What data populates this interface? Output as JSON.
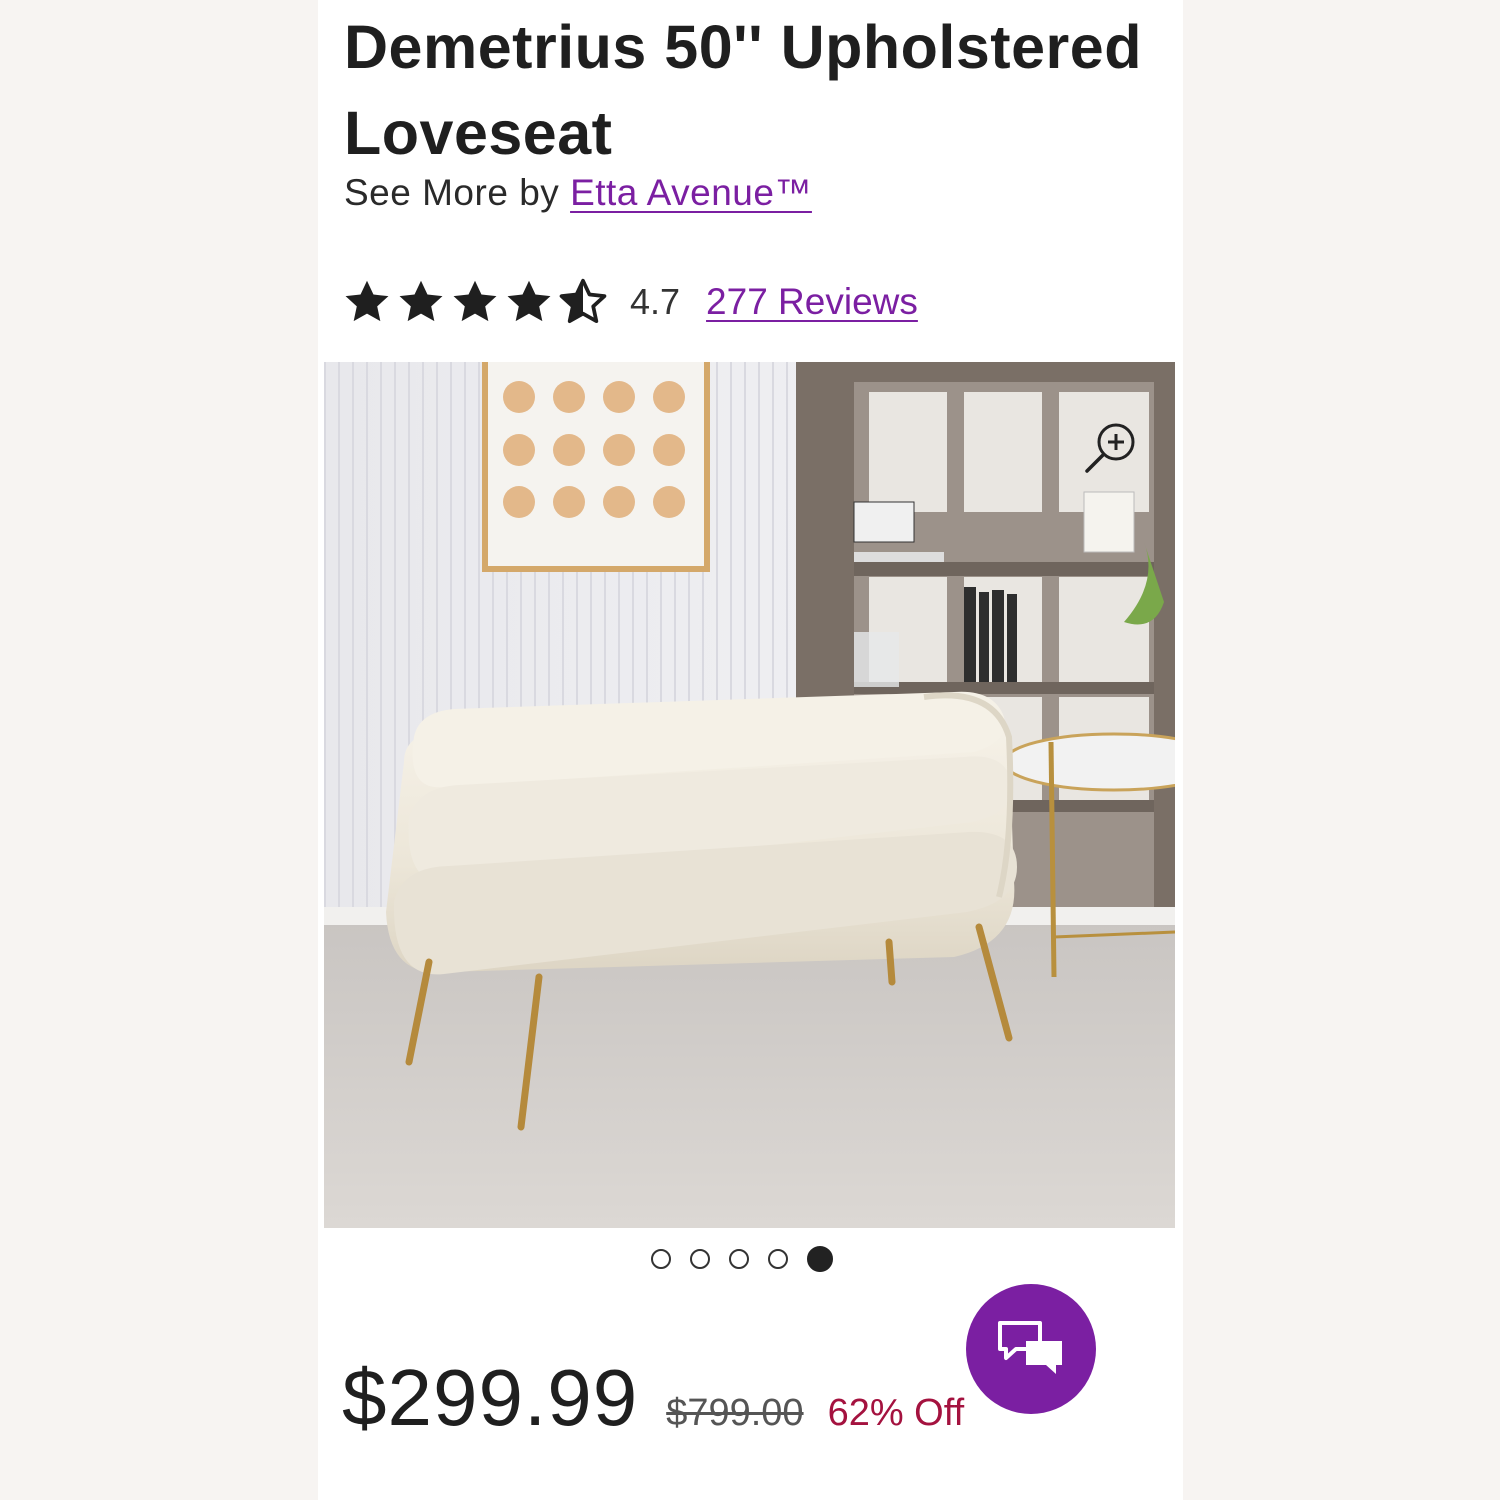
{
  "product": {
    "title": "Demetrius 50'' Upholstered Loveseat",
    "brand_prefix": "See More by",
    "brand_name": "Etta Avenue™",
    "rating_value": "4.7",
    "rating_stars": 4.7,
    "reviews_label": "277 Reviews"
  },
  "gallery": {
    "image_count": 5,
    "active_index": 5,
    "image_alt": "Cream channel-tufted loveseat with gold legs in a living room"
  },
  "pricing": {
    "current_price": "$299.99",
    "original_price": "$799.00",
    "discount_label": "62% Off"
  },
  "colors": {
    "accent": "#7b1fa2",
    "discount": "#a4123f",
    "text": "#1f1f1f"
  },
  "icons": {
    "zoom": "zoom-in-icon",
    "chat": "chat-bubbles-icon",
    "star": "star-icon"
  }
}
